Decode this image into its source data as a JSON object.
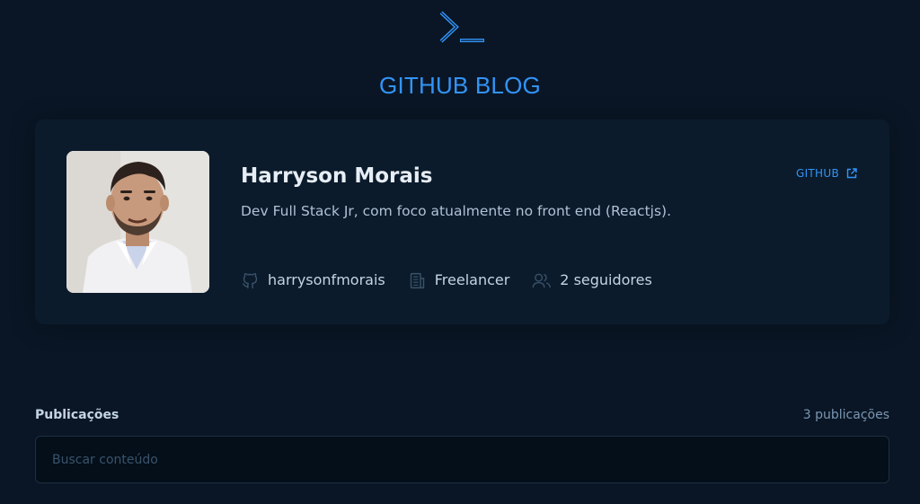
{
  "brand": {
    "title": "GITHUB BLOG",
    "logo_icon": "terminal-prompt-icon",
    "accent_color": "#3294f8"
  },
  "profile": {
    "name": "Harryson Morais",
    "bio": "Dev Full Stack Jr, com foco atualmente no front end (Reactjs).",
    "github_link_label": "GITHUB",
    "github_link_icon": "external-link-icon",
    "avatar_icon": "profile-photo",
    "meta": {
      "username": "harrysonfmorais",
      "company": "Freelancer",
      "followers": "2 seguidores"
    }
  },
  "publications": {
    "title": "Publicações",
    "count": "3 publicações",
    "search_placeholder": "Buscar conteúdo"
  }
}
